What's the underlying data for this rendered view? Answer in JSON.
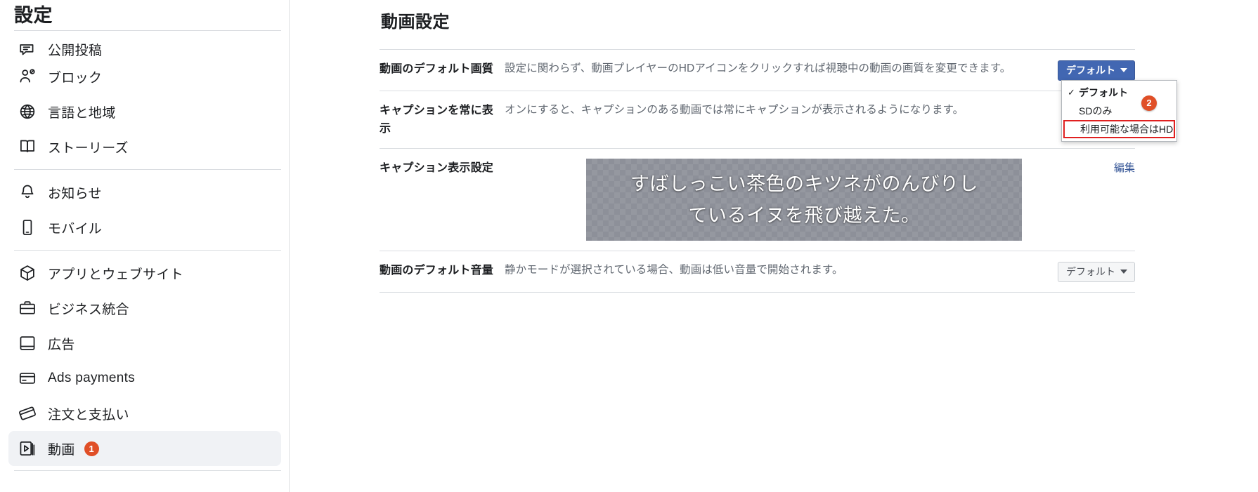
{
  "sidebar": {
    "title": "設定",
    "items": [
      {
        "label": "公開投稿",
        "icon": "comment-icon",
        "name": "sidebar-item-public-posts",
        "selected": false,
        "badge": null,
        "divider_after": false,
        "clipped": true
      },
      {
        "label": "ブロック",
        "icon": "user-block-icon",
        "name": "sidebar-item-blocking",
        "selected": false,
        "badge": null,
        "divider_after": false,
        "clipped": false
      },
      {
        "label": "言語と地域",
        "icon": "globe-icon",
        "name": "sidebar-item-language",
        "selected": false,
        "badge": null,
        "divider_after": false,
        "clipped": false
      },
      {
        "label": "ストーリーズ",
        "icon": "book-icon",
        "name": "sidebar-item-stories",
        "selected": false,
        "badge": null,
        "divider_after": true,
        "clipped": false
      },
      {
        "label": "お知らせ",
        "icon": "bell-icon",
        "name": "sidebar-item-notifications",
        "selected": false,
        "badge": null,
        "divider_after": false,
        "clipped": false
      },
      {
        "label": "モバイル",
        "icon": "mobile-icon",
        "name": "sidebar-item-mobile",
        "selected": false,
        "badge": null,
        "divider_after": true,
        "clipped": false
      },
      {
        "label": "アプリとウェブサイト",
        "icon": "cube-icon",
        "name": "sidebar-item-apps-websites",
        "selected": false,
        "badge": null,
        "divider_after": false,
        "clipped": false
      },
      {
        "label": "ビジネス統合",
        "icon": "briefcase-icon",
        "name": "sidebar-item-business-integrations",
        "selected": false,
        "badge": null,
        "divider_after": false,
        "clipped": false
      },
      {
        "label": "広告",
        "icon": "monitor-icon",
        "name": "sidebar-item-ads",
        "selected": false,
        "badge": null,
        "divider_after": false,
        "clipped": false
      },
      {
        "label": "Ads payments",
        "icon": "credit-card-icon",
        "name": "sidebar-item-ads-payments",
        "selected": false,
        "badge": null,
        "divider_after": false,
        "clipped": false
      },
      {
        "label": "注文と支払い",
        "icon": "payment-card-icon",
        "name": "sidebar-item-orders-payments",
        "selected": false,
        "badge": null,
        "divider_after": false,
        "clipped": false
      },
      {
        "label": "動画",
        "icon": "video-icon",
        "name": "sidebar-item-videos",
        "selected": true,
        "badge": "1",
        "divider_after": true,
        "clipped": false
      }
    ]
  },
  "main": {
    "title": "動画設定",
    "rows": [
      {
        "name": "row-default-video-quality",
        "label": "動画のデフォルト画質",
        "description": "設定に関わらず、動画プレイヤーのHDアイコンをクリックすれば視聴中の動画の画質を変更できます。",
        "control": "quality-dropdown"
      },
      {
        "name": "row-always-show-captions",
        "label": "キャプションを常に表示",
        "description": "オンにすると、キャプションのある動画では常にキャプションが表示されるようになります。",
        "control": "none"
      },
      {
        "name": "row-caption-display-settings",
        "label": "キャプション表示設定",
        "description": "",
        "control": "caption-preview"
      },
      {
        "name": "row-default-video-volume",
        "label": "動画のデフォルト音量",
        "description": "静かモードが選択されている場合、動画は低い音量で開始されます。",
        "control": "volume-dropdown"
      }
    ],
    "quality_button": {
      "label": "デフォルト"
    },
    "volume_button": {
      "label": "デフォルト"
    },
    "edit_link": {
      "label": "編集"
    },
    "caption_preview": {
      "line1": "すばしっこい茶色のキツネがのんびりし",
      "line2": "ているイヌを飛び越えた。"
    },
    "dropdown": {
      "open": true,
      "badge": "2",
      "items": [
        {
          "label": "デフォルト",
          "checked": true,
          "highlighted": false,
          "name": "dropdown-option-default"
        },
        {
          "label": "SDのみ",
          "checked": false,
          "highlighted": false,
          "name": "dropdown-option-sd-only"
        },
        {
          "label": "利用可能な場合はHD",
          "checked": false,
          "highlighted": true,
          "name": "dropdown-option-hd-when-available"
        }
      ]
    }
  },
  "colors": {
    "primary_blue": "#4267b2",
    "link_blue": "#385898",
    "badge_orange": "#e04f27",
    "highlight_red": "#e02020",
    "selected_bg": "#f0f2f5",
    "text_dark": "#1c1e21",
    "text_muted": "#606770",
    "divider": "#dadde1",
    "caption_bg": "#8d9099"
  }
}
